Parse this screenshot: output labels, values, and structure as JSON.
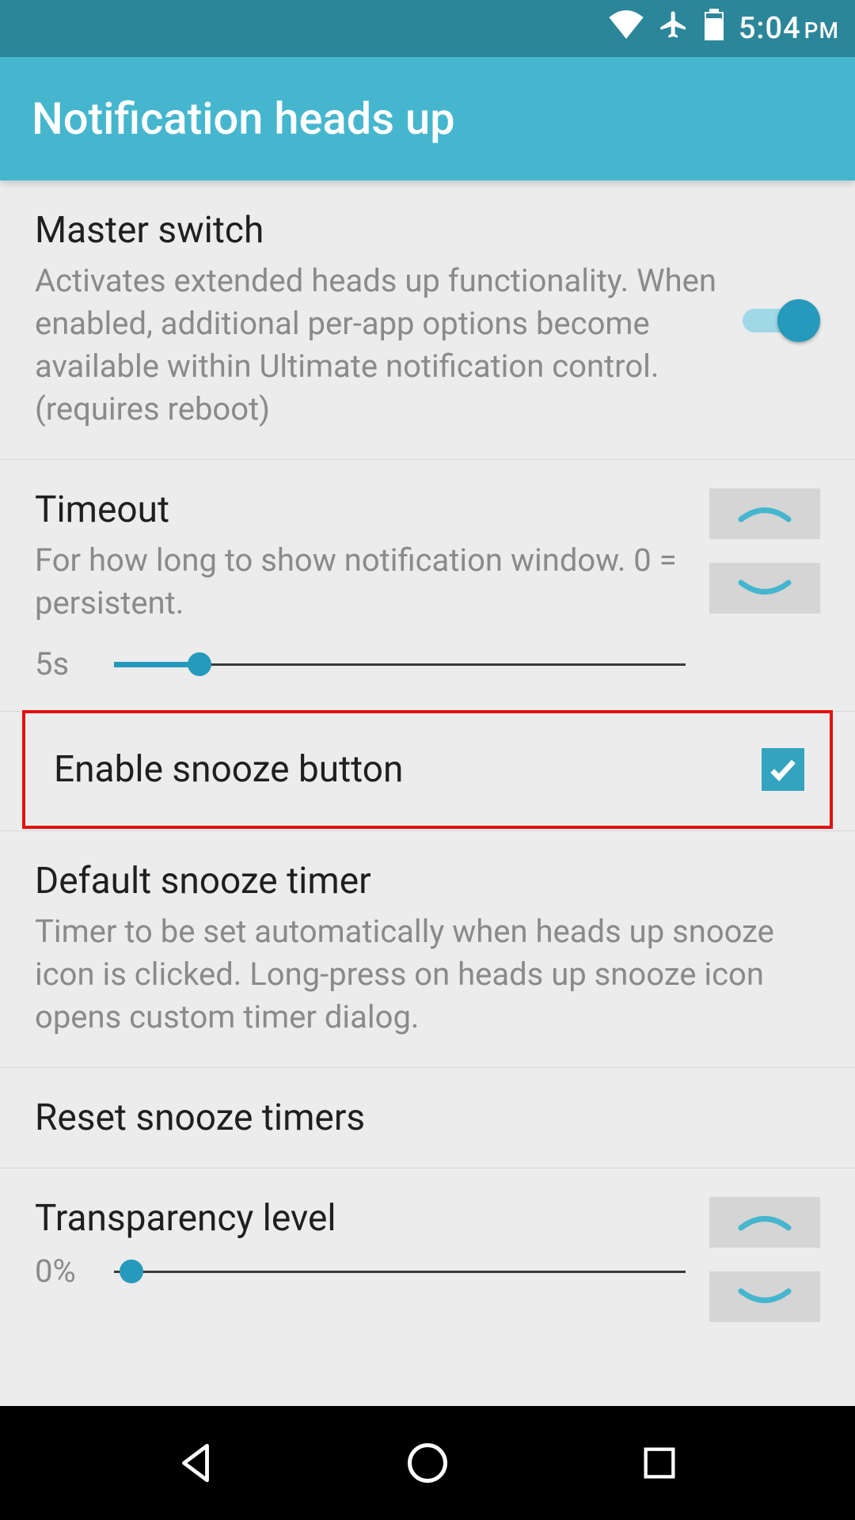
{
  "status": {
    "time": "5:04",
    "ampm": "PM",
    "icons": {
      "wifi": "wifi-icon",
      "airplane": "airplane-icon",
      "battery": "battery-icon"
    }
  },
  "appbar": {
    "title": "Notification heads up"
  },
  "settings": {
    "master": {
      "title": "Master switch",
      "desc": "Activates extended heads up functionality. When enabled, additional per-app options become available within Ultimate notification control. (requires reboot)",
      "on": true
    },
    "timeout": {
      "title": "Timeout",
      "desc": "For how long to show notification window. 0 = persistent.",
      "value_label": "5s",
      "value_pct": 15
    },
    "snooze": {
      "title": "Enable snooze button",
      "checked": true,
      "highlighted": true
    },
    "default_timer": {
      "title": "Default snooze timer",
      "desc": "Timer to be set automatically when heads up snooze icon is clicked. Long-press on heads up snooze icon opens custom timer dialog."
    },
    "reset": {
      "title": "Reset snooze timers"
    },
    "transparency": {
      "title": "Transparency level",
      "value_label": "0%",
      "value_pct": 0
    }
  }
}
